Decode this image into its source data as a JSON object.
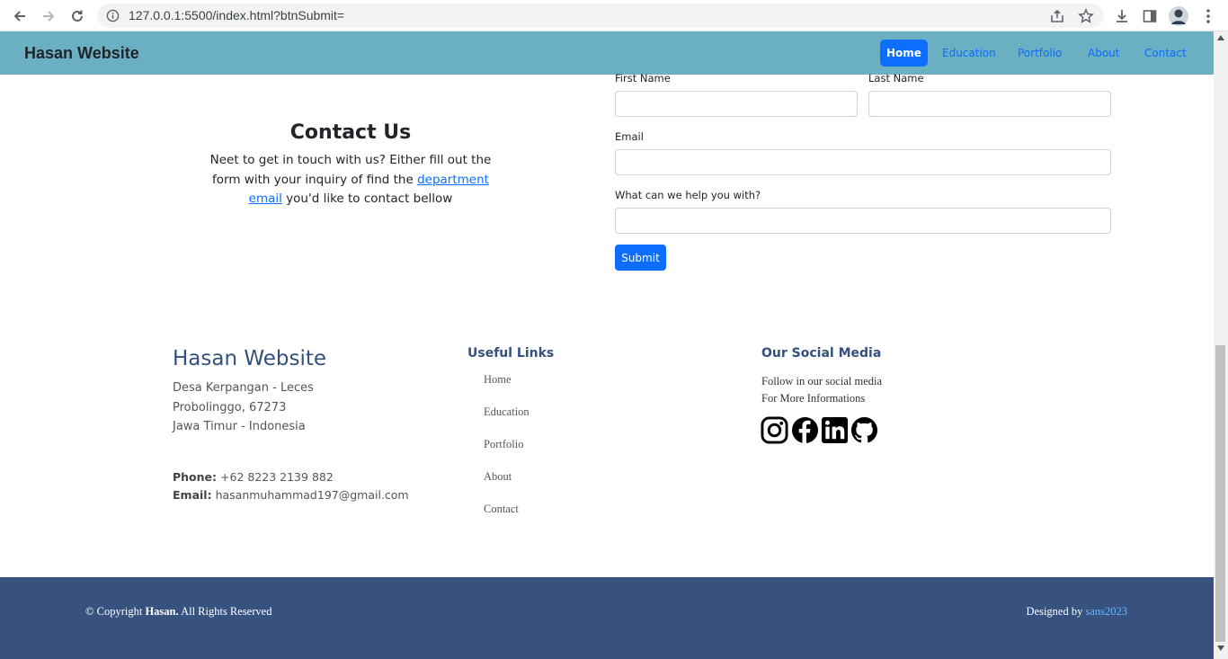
{
  "browser": {
    "url": "127.0.0.1:5500/index.html?btnSubmit="
  },
  "navbar": {
    "brand": "Hasan Website",
    "links": [
      "Home",
      "Education",
      "Portfolio",
      "About",
      "Contact"
    ]
  },
  "contact": {
    "title": "Contact Us",
    "text_before": "Neet to get in touch with us? Either fill out the form with your inquiry of find the",
    "link_text": "department email",
    "text_after": "you'd like to contact bellow",
    "form": {
      "first_name_label": "First Name",
      "last_name_label": "Last Name",
      "email_label": "Email",
      "help_label": "What can we help you with?",
      "submit_label": "Submit"
    }
  },
  "footer": {
    "brand": "Hasan Website",
    "address_line1": "Desa Kerpangan - Leces",
    "address_line2": "Probolinggo, 67273",
    "address_line3": "Jawa Timur - Indonesia",
    "phone_label": "Phone:",
    "phone": "+62 8223 2139 882",
    "email_label": "Email:",
    "email": "hasanmuhammad197@gmail.com",
    "useful_links_title": "Useful Links",
    "useful_links": [
      "Home",
      "Education",
      "Portfolio",
      "About",
      "Contact"
    ],
    "social_title": "Our Social Media",
    "social_line1": "Follow in our social media",
    "social_line2": "For More Informations",
    "social_icons": [
      "instagram-icon",
      "facebook-icon",
      "linkedin-icon",
      "github-icon"
    ]
  },
  "bottom": {
    "copyright_prefix": "© Copyright",
    "copyright_name": "Hasan.",
    "copyright_suffix": "All Rights Reserved",
    "designed_prefix": "Designed by",
    "designed_link": "sans2023"
  },
  "colors": {
    "navbar": "#6aafc2",
    "primary": "#0d6efd",
    "footer_bar": "#385280",
    "footer_heading": "#34507c"
  }
}
